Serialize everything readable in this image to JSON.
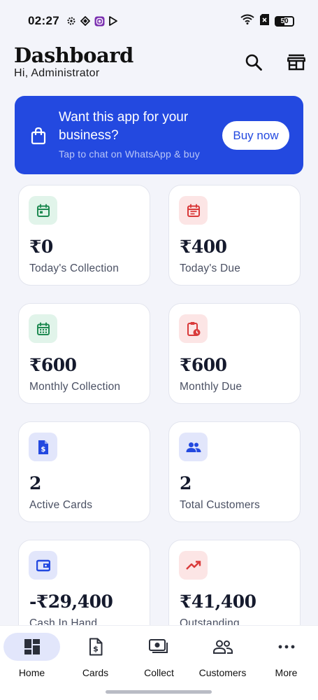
{
  "status_bar": {
    "time": "02:27",
    "battery": "50"
  },
  "header": {
    "title": "Dashboard",
    "greeting": "Hi, Administrator"
  },
  "promo": {
    "title": "Want this app for your business?",
    "subtitle": "Tap to chat on WhatsApp & buy",
    "button": "Buy now"
  },
  "cards": [
    {
      "value": "₹0",
      "label": "Today's Collection",
      "icon": "calendar-icon",
      "tone": "green"
    },
    {
      "value": "₹400",
      "label": "Today's Due",
      "icon": "calendar-list-icon",
      "tone": "red"
    },
    {
      "value": "₹600",
      "label": "Monthly Collection",
      "icon": "calendar-month-icon",
      "tone": "green"
    },
    {
      "value": "₹600",
      "label": "Monthly Due",
      "icon": "clipboard-clock-icon",
      "tone": "red"
    },
    {
      "value": "2",
      "label": "Active Cards",
      "icon": "document-rupee-icon",
      "tone": "blue"
    },
    {
      "value": "2",
      "label": "Total Customers",
      "icon": "people-icon",
      "tone": "blue"
    },
    {
      "value": "-₹29,400",
      "label": "Cash In Hand",
      "icon": "wallet-icon",
      "tone": "blue"
    },
    {
      "value": "₹41,400",
      "label": "Outstanding",
      "icon": "trending-up-icon",
      "tone": "red"
    }
  ],
  "nav": [
    {
      "label": "Home",
      "icon": "dashboard-icon",
      "active": true
    },
    {
      "label": "Cards",
      "icon": "document-rupee-icon"
    },
    {
      "label": "Collect",
      "icon": "cash-icon"
    },
    {
      "label": "Customers",
      "icon": "people-icon"
    },
    {
      "label": "More",
      "icon": "more-dots-icon"
    }
  ],
  "colors": {
    "primary": "#2349e0",
    "green": "#1f8a52",
    "red": "#d93a3a",
    "blue": "#2349e0",
    "background": "#f3f4fa"
  }
}
